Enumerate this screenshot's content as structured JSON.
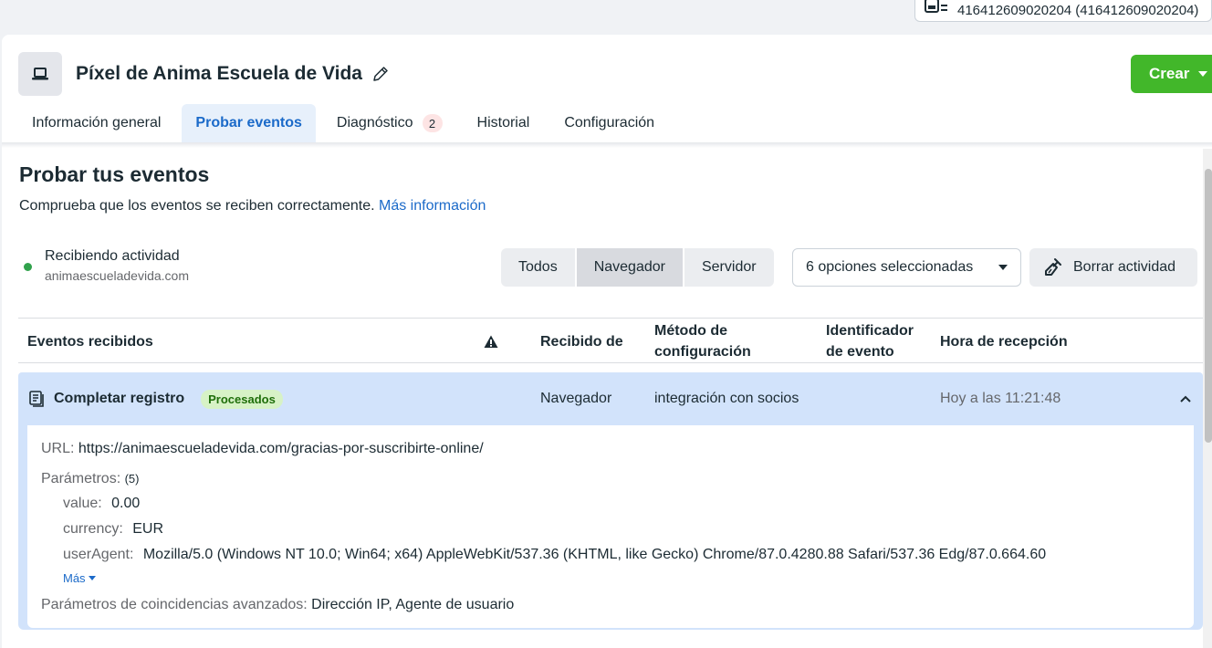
{
  "account": {
    "label": "416412609020204 (416412609020204)",
    "icon": "business-manager-icon"
  },
  "header": {
    "title": "Píxel de Anima Escuela de Vida",
    "pixel_icon": "monitor-icon",
    "edit_icon": "pencil-icon",
    "create_label": "Crear"
  },
  "tabs": [
    {
      "label": "Información general",
      "active": false
    },
    {
      "label": "Probar eventos",
      "active": true
    },
    {
      "label": "Diagnóstico",
      "active": false,
      "badge": "2"
    },
    {
      "label": "Historial",
      "active": false
    },
    {
      "label": "Configuración",
      "active": false
    }
  ],
  "section": {
    "title": "Probar tus eventos",
    "description": "Comprueba que los eventos se reciben correctamente.",
    "link": "Más información"
  },
  "status": {
    "label": "Recibiendo actividad",
    "domain": "animaescueladevida.com",
    "color": "#31a24c"
  },
  "filters": {
    "segments": [
      "Todos",
      "Navegador",
      "Servidor"
    ],
    "selected": "Navegador",
    "dropdown": "6 opciones seleccionadas",
    "clear_label": "Borrar actividad"
  },
  "table": {
    "columns": [
      "Eventos recibidos",
      "",
      "Recibido de",
      "Método de configuración",
      "Identificador de evento",
      "Hora de recepción"
    ],
    "warning_icon": "warning-icon"
  },
  "event": {
    "name": "Completar registro",
    "badge": "Procesados",
    "received_from": "Navegador",
    "method": "integración con socios",
    "event_id": "",
    "time": "Hoy a las 11:21:48",
    "details": {
      "url_label": "URL:",
      "url": "https://animaescueladevida.com/gracias-por-suscribirte-online/",
      "params_label": "Parámetros:",
      "params_count": "(5)",
      "params": [
        {
          "key": "value:",
          "value": "0.00"
        },
        {
          "key": "currency:",
          "value": "EUR"
        },
        {
          "key": "userAgent:",
          "value": "Mozilla/5.0 (Windows NT 10.0; Win64; x64) AppleWebKit/537.36 (KHTML, like Gecko) Chrome/87.0.4280.88 Safari/537.36 Edg/87.0.664.60"
        }
      ],
      "more_label": "Más",
      "advanced_label": "Parámetros de coincidencias avanzados:",
      "advanced_value": "Dirección IP, Agente de usuario"
    }
  }
}
